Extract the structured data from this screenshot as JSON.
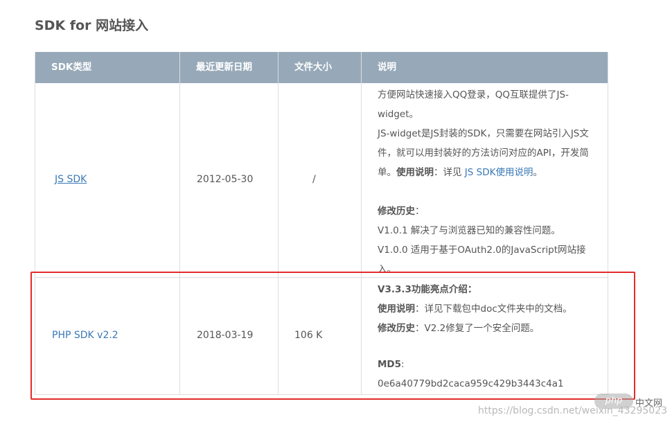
{
  "page": {
    "title": "SDK for 网站接入"
  },
  "table": {
    "headers": [
      "SDK类型",
      "最近更新日期",
      "文件大小",
      "说明"
    ],
    "rows": [
      {
        "sdk": "JS SDK",
        "date": "2012-05-30",
        "size": "/",
        "desc": {
          "l1": "方便网站快速接入QQ登录，QQ互联提供了JS-",
          "l2": "widget。",
          "l3": "JS-widget是JS封装的SDK，只需要在网站引入JS文",
          "l4": "件，就可以用封装好的方法访问对应的API，开发简",
          "l5_pre": "单。",
          "l5_bold": "使用说明",
          "l5_mid": "：详见 ",
          "l5_link": "JS SDK使用说明",
          "l5_end": "。",
          "history_label": "修改历史",
          "history_colon": "：",
          "v1": "V1.0.1 解决了与浏览器已知的兼容性问题。",
          "v2a": "V1.0.0 适用于基于OAuth2.0的JavaScript网站接",
          "v2b": "入。"
        }
      },
      {
        "sdk": "PHP SDK v2.2",
        "date": "2018-03-19",
        "size": "106 K",
        "desc": {
          "feature": "V3.3.3功能亮点介绍：",
          "usage_label": "使用说明",
          "usage_text": "：详见下载包中doc文件夹中的文档。",
          "history_label": "修改历史",
          "history_text": "：V2.2修复了一个安全问题。",
          "md5_label": "MD5",
          "md5_colon": ":",
          "md5_value": "0e6a40779bd2caca959c429b3443c4a1"
        }
      }
    ]
  },
  "watermark": {
    "logo": "php",
    "logo_suffix": "中文网",
    "url": "https://blog.csdn.net/weixin_43295023"
  },
  "colors": {
    "header_bg": "#97a9b9",
    "link": "#3a78b6",
    "highlight_border": "#e32b2b"
  }
}
